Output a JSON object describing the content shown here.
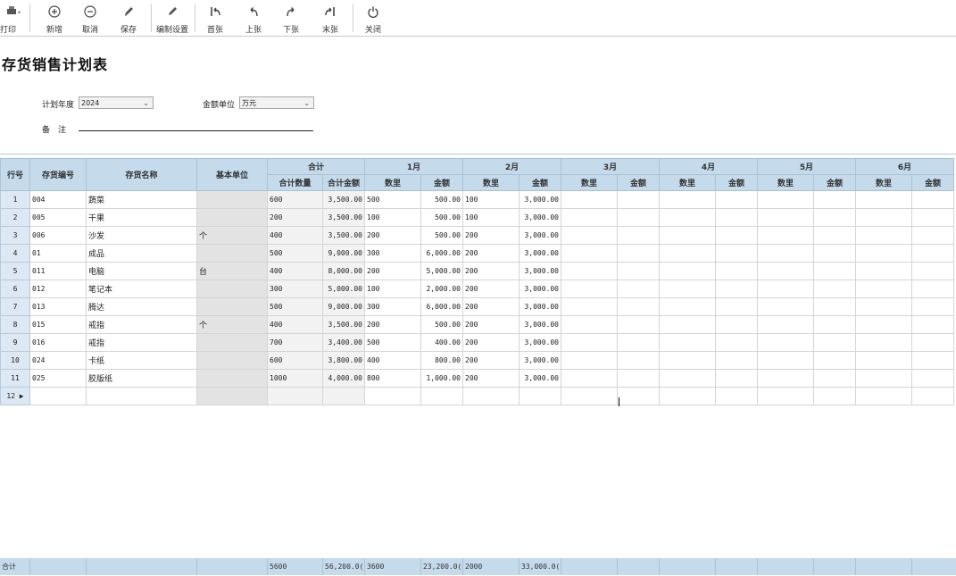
{
  "toolbar": {
    "print_label": "打印",
    "new_label": "新增",
    "cancel_label": "取消",
    "save_label": "保存",
    "settings_label": "编制设置",
    "first_label": "首张",
    "prev_label": "上张",
    "next_label": "下张",
    "last_label": "末张",
    "close_label": "关闭"
  },
  "page": {
    "title": "存货销售计划表"
  },
  "form": {
    "year_label": "计划年度",
    "year_value": "2024",
    "unit_label": "金额单位",
    "unit_value": "万元",
    "remark_label": "备　注"
  },
  "grid": {
    "headers": {
      "row_no": "行号",
      "code": "存货编号",
      "name": "存货名称",
      "unit": "基本单位",
      "total": "合计",
      "total_qty": "合计数量",
      "total_amt": "合计金额",
      "months": [
        "1月",
        "2月",
        "3月",
        "4月",
        "5月",
        "6月"
      ],
      "qty": "数里",
      "amt": "金额"
    },
    "rows": [
      {
        "no": "1",
        "code": "004",
        "name": "蔬菜",
        "unit": "",
        "tq": "600",
        "ta": "3,500.00",
        "m1q": "500",
        "m1a": "500.00",
        "m2q": "100",
        "m2a": "3,000.00"
      },
      {
        "no": "2",
        "code": "005",
        "name": "干果",
        "unit": "",
        "tq": "200",
        "ta": "3,500.00",
        "m1q": "100",
        "m1a": "500.00",
        "m2q": "100",
        "m2a": "3,000.00"
      },
      {
        "no": "3",
        "code": "006",
        "name": "沙发",
        "unit": "个",
        "tq": "400",
        "ta": "3,500.00",
        "m1q": "200",
        "m1a": "500.00",
        "m2q": "200",
        "m2a": "3,000.00"
      },
      {
        "no": "4",
        "code": "01",
        "name": "成品",
        "unit": "",
        "tq": "500",
        "ta": "9,000.00",
        "m1q": "300",
        "m1a": "6,000.00",
        "m2q": "200",
        "m2a": "3,000.00"
      },
      {
        "no": "5",
        "code": "011",
        "name": "电脑",
        "unit": "台",
        "tq": "400",
        "ta": "8,000.00",
        "m1q": "200",
        "m1a": "5,000.00",
        "m2q": "200",
        "m2a": "3,000.00"
      },
      {
        "no": "6",
        "code": "012",
        "name": "笔记本",
        "unit": "",
        "tq": "300",
        "ta": "5,000.00",
        "m1q": "100",
        "m1a": "2,000.00",
        "m2q": "200",
        "m2a": "3,000.00"
      },
      {
        "no": "7",
        "code": "013",
        "name": "腾达",
        "unit": "",
        "tq": "500",
        "ta": "9,000.00",
        "m1q": "300",
        "m1a": "6,000.00",
        "m2q": "200",
        "m2a": "3,000.00"
      },
      {
        "no": "8",
        "code": "015",
        "name": "戒指",
        "unit": "个",
        "tq": "400",
        "ta": "3,500.00",
        "m1q": "200",
        "m1a": "500.00",
        "m2q": "200",
        "m2a": "3,000.00"
      },
      {
        "no": "9",
        "code": "016",
        "name": "戒指",
        "unit": "",
        "tq": "700",
        "ta": "3,400.00",
        "m1q": "500",
        "m1a": "400.00",
        "m2q": "200",
        "m2a": "3,000.00"
      },
      {
        "no": "10",
        "code": "024",
        "name": "卡纸",
        "unit": "",
        "tq": "600",
        "ta": "3,800.00",
        "m1q": "400",
        "m1a": "800.00",
        "m2q": "200",
        "m2a": "3,000.00"
      },
      {
        "no": "11",
        "code": "025",
        "name": "胶版纸",
        "unit": "",
        "tq": "1000",
        "ta": "4,000.00",
        "m1q": "800",
        "m1a": "1,000.00",
        "m2q": "200",
        "m2a": "3,000.00"
      },
      {
        "no": "12 ▶",
        "code": "",
        "name": "",
        "unit": "",
        "tq": "",
        "ta": "",
        "m1q": "",
        "m1a": "",
        "m2q": "",
        "m2a": ""
      }
    ],
    "footer": {
      "label": "合计",
      "tq": "5600",
      "ta": "56,200.0(",
      "m1q": "3600",
      "m1a": "23,200.0(",
      "m2q": "2000",
      "m2a": "33,000.0("
    }
  }
}
